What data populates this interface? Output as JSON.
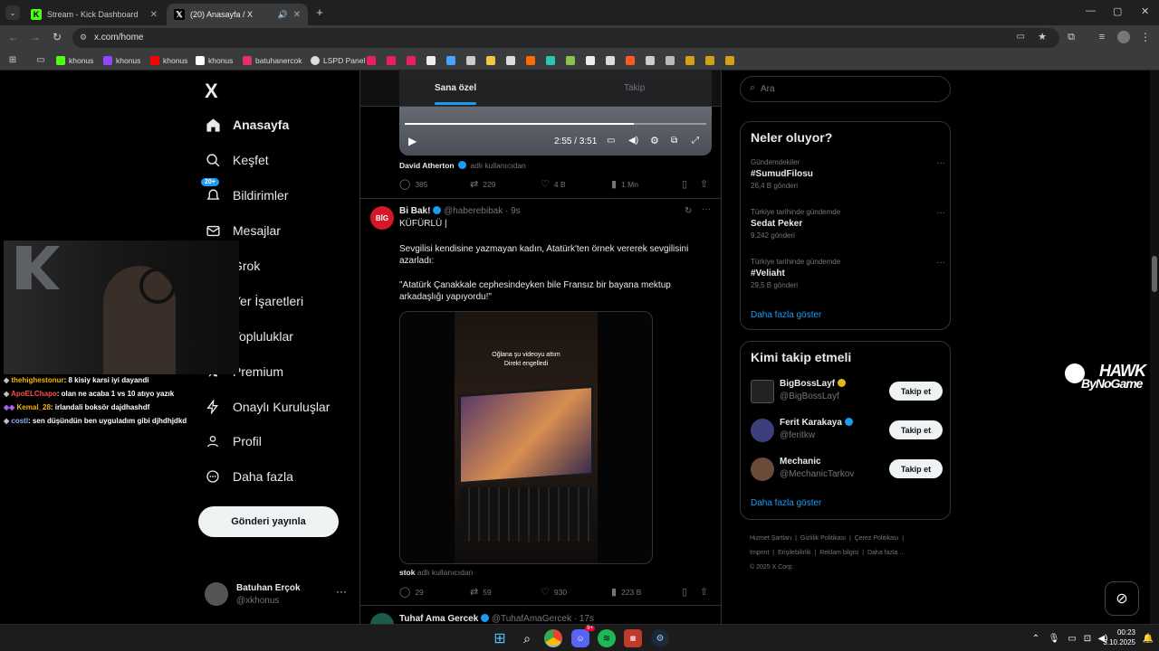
{
  "browser": {
    "tabs": [
      {
        "title": "Stream - Kick Dashboard",
        "icon": "kick-icon",
        "active": false
      },
      {
        "title": "(20) Anasayfa / X",
        "icon": "x-icon",
        "active": true
      }
    ],
    "url": "x.com/home",
    "bookmarks": [
      {
        "label": "khonus",
        "icon": "kick-icon",
        "color": "#53fc18"
      },
      {
        "label": "khonus",
        "icon": "twitch-icon",
        "color": "#9146ff"
      },
      {
        "label": "khonus",
        "icon": "youtube-icon",
        "color": "#ff0000"
      },
      {
        "label": "khonus",
        "icon": "x-icon",
        "color": "#ffffff"
      },
      {
        "label": "batuhanercok",
        "icon": "instagram-icon",
        "color": "#e1306c"
      },
      {
        "label": "LSPD Panel",
        "icon": "lspd-icon",
        "color": "#ffffff"
      }
    ]
  },
  "sidebar": {
    "logo": "X",
    "items": [
      {
        "label": "Anasayfa",
        "icon": "home-icon",
        "bold": true
      },
      {
        "label": "Keşfet",
        "icon": "search-icon"
      },
      {
        "label": "Bildirimler",
        "icon": "bell-icon",
        "badge": "20+"
      },
      {
        "label": "Mesajlar",
        "icon": "mail-icon"
      },
      {
        "label": "Grok",
        "icon": "grok-icon"
      },
      {
        "label": "Yer İşaretleri",
        "icon": "bookmark-icon"
      },
      {
        "label": "Topluluklar",
        "icon": "communities-icon"
      },
      {
        "label": "Premium",
        "icon": "x-premium-icon"
      },
      {
        "label": "Onaylı Kuruluşlar",
        "icon": "lightning-icon"
      },
      {
        "label": "Profil",
        "icon": "person-icon"
      },
      {
        "label": "Daha fazla",
        "icon": "more-circle-icon"
      }
    ],
    "post_button": "Gönderi yayınla",
    "account": {
      "name": "Batuhan Erçok",
      "handle": "@xkhonus"
    }
  },
  "feed": {
    "tabs": [
      "Sana özel",
      "Takip"
    ],
    "video1": {
      "time": "2:55 / 3:51",
      "caption_name": "David Atherton",
      "caption_suffix": "adlı kullanıcıdan"
    },
    "post1_actions": {
      "replies": "385",
      "reposts": "229",
      "likes": "4 B",
      "views": "1 Mn"
    },
    "post2": {
      "name": "Bi Bak!",
      "handle": "@haberebibak",
      "time": "· 9s",
      "line1": "KÜFÜRLÜ |",
      "line2": "Sevgilisi kendisine yazmayan kadın, Atatürk'ten örnek vererek sevgilisini azarladı:",
      "line3": "\"Atatürk Çanakkale cephesindeyken bile Fransız bir bayana mektup arkadaşlığı yapıyordu!\"",
      "media_text1": "Oğlana şu videoyu attım",
      "media_text2": "Direkt engelledi",
      "caption_name": "stok",
      "caption_suffix": "adlı kullanıcıdan",
      "actions": {
        "replies": "29",
        "reposts": "59",
        "likes": "930",
        "views": "223 B"
      }
    },
    "post3": {
      "name": "Tuhaf Ama Gercek",
      "handle": "@TuhafAmaGercek",
      "time": "· 17s"
    }
  },
  "right": {
    "search_placeholder": "Ara",
    "trends_title": "Neler oluyor?",
    "trends": [
      {
        "meta": "Gündemdekiler",
        "name": "#SumudFilosu",
        "count": "26,4 B gönderi"
      },
      {
        "meta": "Türkiye tarihinde gündemde",
        "name": "Sedat Peker",
        "count": "9.242 gönderi"
      },
      {
        "meta": "Türkiye tarihinde gündemde",
        "name": "#Veliaht",
        "count": "29,5 B gönderi"
      }
    ],
    "trends_more": "Daha fazla göster",
    "follow_title": "Kimi takip etmeli",
    "follow": [
      {
        "name": "BigBossLayf",
        "handle": "@BigBossLayf",
        "verified_color": "#e2b719"
      },
      {
        "name": "Ferit Karakaya",
        "handle": "@feritkw",
        "verified_color": "#1d9bf0"
      },
      {
        "name": "Mechanic",
        "handle": "@MechanicTarkov",
        "verified_color": ""
      }
    ],
    "follow_button": "Takip et",
    "follow_more": "Daha fazla göster",
    "footer_line1": [
      "Hizmet Şartları",
      "Gizlilik Politikası",
      "Çerez Politikası"
    ],
    "footer_line2": [
      "İmprint",
      "Erişilebilirlik",
      "Reklam bilgisi",
      "Daha fazla ..."
    ],
    "copyright": "© 2025 X Corp."
  },
  "overlay": {
    "chat": [
      {
        "user": "thehighestonur",
        "msg": ": 8 kisiy karsi iyi dayandi",
        "color": "#f7b500"
      },
      {
        "user": "ApoELChapo",
        "msg": ": olan ne acaba 1 vs 10 atıyo yazık",
        "color": "#ff4d4d"
      },
      {
        "user": "Kemal_28",
        "msg": ": irlandali boksör dajdhashdf",
        "color": "#f7b500"
      },
      {
        "user": "costl",
        "msg": ": sen düşündün ben uyguladım gibi djhdhjdkd",
        "color": "#8ab4ff"
      }
    ],
    "brand_top": "HAWK",
    "brand_bottom": "ByNoGame"
  },
  "taskbar": {
    "time": "00:23",
    "date": "3.10.2025",
    "discord_badge": "9+"
  }
}
